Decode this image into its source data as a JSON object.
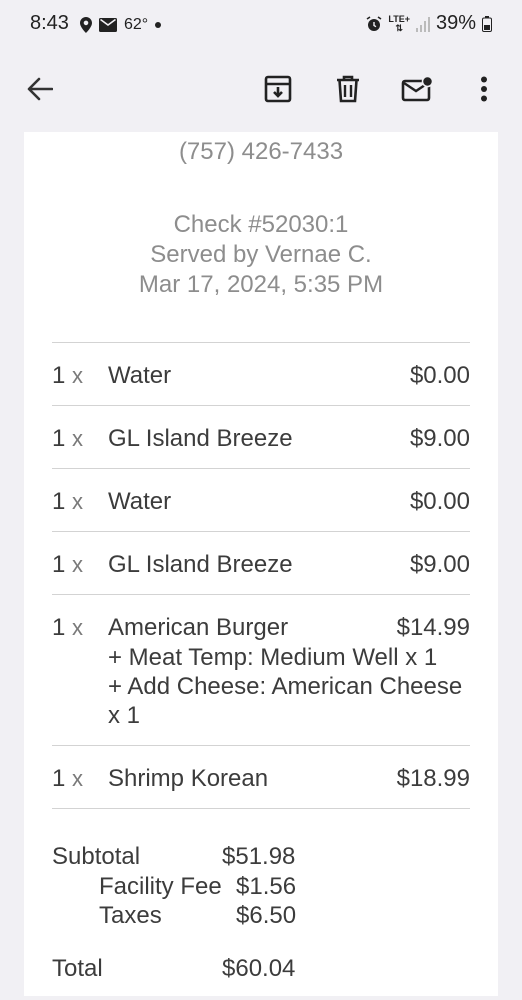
{
  "status_bar": {
    "time": "8:43",
    "temperature": "62°",
    "network": "LTE+",
    "battery": "39%"
  },
  "toolbar": {
    "back_icon": "arrow-left-icon",
    "archive_icon": "archive-icon",
    "delete_icon": "trash-icon",
    "mark_unread_icon": "mail-unread-icon",
    "more_icon": "more-vert-icon"
  },
  "receipt": {
    "phone": "(757) 426-7433",
    "check": "Check #52030:1",
    "server": "Served by Vernae C.",
    "datetime": "Mar 17, 2024, 5:35 PM",
    "items": [
      {
        "qty": "1",
        "x": "x",
        "name": "Water",
        "price": "$0.00"
      },
      {
        "qty": "1",
        "x": "x",
        "name": "GL Island Breeze",
        "price": "$9.00"
      },
      {
        "qty": "1",
        "x": "x",
        "name": "Water",
        "price": "$0.00"
      },
      {
        "qty": "1",
        "x": "x",
        "name": "GL Island Breeze",
        "price": "$9.00"
      },
      {
        "qty": "1",
        "x": "x",
        "name": "American Burger",
        "price": "$14.99",
        "modifiers": [
          "+ Meat Temp: Medium Well x 1",
          "+ Add Cheese: American Cheese",
          "x 1"
        ]
      },
      {
        "qty": "1",
        "x": "x",
        "name": "Shrimp Korean",
        "price": "$18.99"
      }
    ],
    "totals": {
      "subtotal_label": "Subtotal",
      "subtotal_value": "$51.98",
      "facility_fee_label": "Facility Fee",
      "facility_fee_value": "$1.56",
      "taxes_label": "Taxes",
      "taxes_value": "$6.50",
      "total_label": "Total",
      "total_value": "$60.04"
    }
  }
}
